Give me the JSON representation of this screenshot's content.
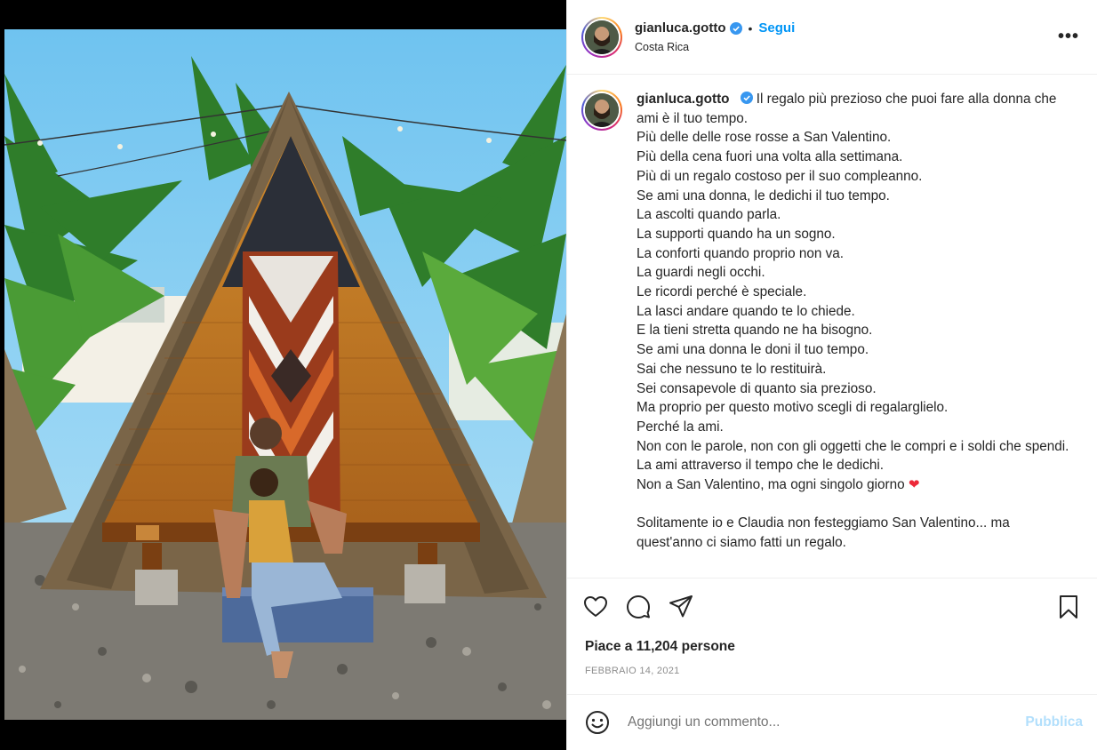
{
  "header": {
    "username": "gianluca.gotto",
    "separator": "•",
    "follow_label": "Segui",
    "location": "Costa Rica",
    "more_label": "•••"
  },
  "caption": {
    "username": "gianluca.gotto",
    "first_line": "Il regalo più prezioso che puoi fare alla donna che ami è il tuo tempo.",
    "lines": [
      "Più delle delle rose rosse a San Valentino.",
      "Più della cena fuori una volta alla settimana.",
      "Più di un regalo costoso per il suo compleanno.",
      "Se ami una donna, le dedichi il tuo tempo.",
      "La ascolti quando parla.",
      "La supporti quando ha un sogno.",
      "La conforti quando proprio non va.",
      "La guardi negli occhi.",
      "Le ricordi perché è speciale.",
      "La lasci andare quando te lo chiede.",
      "E la tieni stretta quando ne ha bisogno.",
      "Se ami una donna le doni il tuo tempo.",
      "Sai che nessuno te lo restituirà.",
      "Sei consapevole di quanto sia prezioso.",
      "Ma proprio per questo motivo scegli di regalarglielo.",
      "Perché la ami.",
      "Non con le parole, non con gli oggetti che le compri e i soldi che spendi.",
      "La ami attraverso il tempo che le dedichi."
    ],
    "last_line": "Non a San Valentino, ma ogni singolo giorno",
    "heart": "❤",
    "second_paragraph": "Solitamente io e Claudia non festeggiamo San Valentino... ma quest'anno ci siamo fatti un regalo."
  },
  "actions": {
    "icons": [
      "heart-icon",
      "comment-icon",
      "share-icon",
      "bookmark-icon"
    ]
  },
  "likes_text": "Piace a 11,204 persone",
  "date_text": "FEBBRAIO 14, 2021",
  "comment": {
    "placeholder": "Aggiungi un commento...",
    "publish_label": "Pubblica"
  },
  "colors": {
    "accent": "#0095f6",
    "publish_disabled": "#b2dffc",
    "heart": "#ed2939",
    "verified": "#3897f0"
  }
}
